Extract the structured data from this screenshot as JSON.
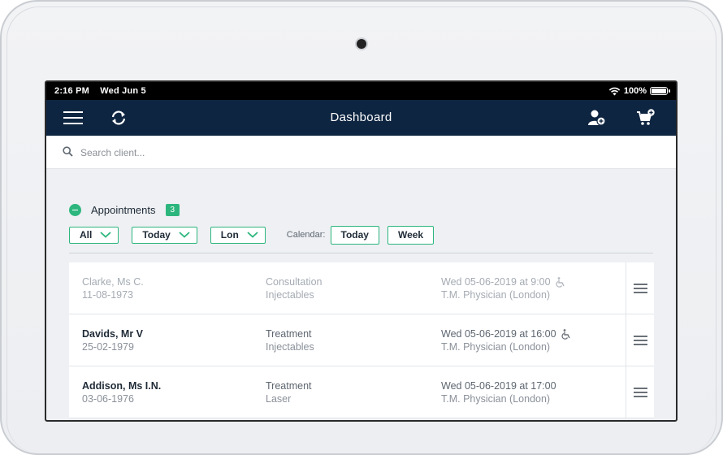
{
  "status": {
    "time": "2:16 PM",
    "date": "Wed Jun 5",
    "battery": "100%"
  },
  "navbar": {
    "title": "Dashboard",
    "icons": [
      "menu-icon",
      "sync-icon",
      "add-user-icon",
      "add-cart-icon"
    ]
  },
  "search": {
    "placeholder": "Search client..."
  },
  "appointments": {
    "title": "Appointments",
    "count": "3",
    "filters": {
      "who": "All",
      "period": "Today",
      "location": "Lon"
    },
    "calendar_label": "Calendar:",
    "calendar_buttons": [
      "Today",
      "Week"
    ],
    "rows": [
      {
        "client": "Clarke, Ms C.",
        "dob": "11-08-1973",
        "type": "Consultation",
        "category": "Injectables",
        "when": "Wed 05-06-2019 at 9:00",
        "practitioner": "T.M. Physician (London)",
        "accessible": true,
        "past": true
      },
      {
        "client": "Davids, Mr V",
        "dob": "25-02-1979",
        "type": "Treatment",
        "category": "Injectables",
        "when": "Wed 05-06-2019 at 16:00",
        "practitioner": "T.M. Physician (London)",
        "accessible": true,
        "past": false
      },
      {
        "client": "Addison, Ms I.N.",
        "dob": "03-06-1976",
        "type": "Treatment",
        "category": "Laser",
        "when": "Wed 05-06-2019 at 17:00",
        "practitioner": "T.M. Physician (London)",
        "accessible": false,
        "past": false
      }
    ]
  },
  "colors": {
    "navbar": "#0e2541",
    "accent": "#2cb67d",
    "background": "#eef0f3"
  }
}
